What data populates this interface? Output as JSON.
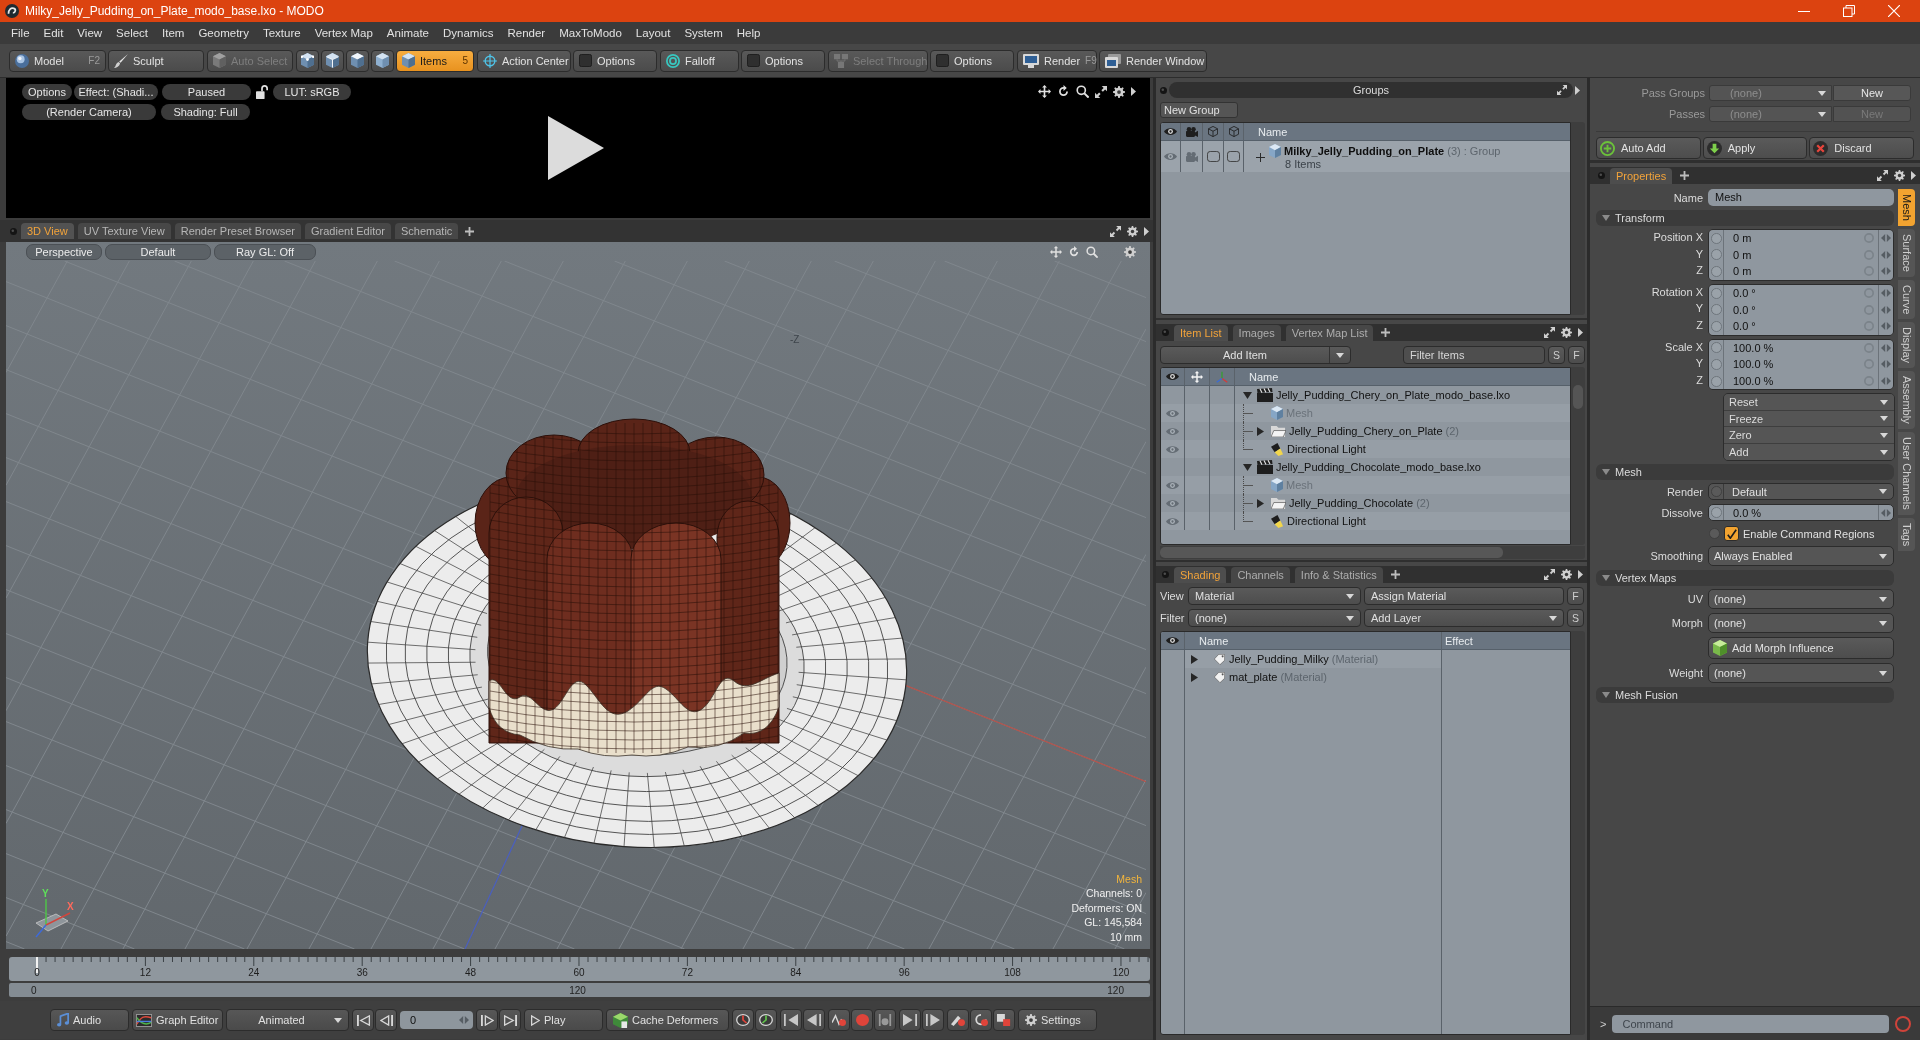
{
  "window": {
    "title": "Milky_Jelly_Pudding_on_Plate_modo_base.lxo - MODO"
  },
  "menu": [
    "File",
    "Edit",
    "View",
    "Select",
    "Item",
    "Geometry",
    "Texture",
    "Vertex Map",
    "Animate",
    "Dynamics",
    "Render",
    "MaxToModo",
    "Layout",
    "System",
    "Help"
  ],
  "toolbar": [
    {
      "items": [
        {
          "kind": "model",
          "label": "Model",
          "shortcut": "F2"
        },
        {
          "kind": "sculpt",
          "label": "Sculpt"
        }
      ]
    },
    {
      "items": [
        {
          "kind": "auto_select",
          "label": "Auto Select",
          "disabled": true
        }
      ]
    },
    {
      "items": [
        {
          "kind": "vertices",
          "selected": false
        },
        {
          "kind": "edges",
          "selected": false
        },
        {
          "kind": "polygons",
          "selected": false
        },
        {
          "kind": "materials",
          "selected": false
        },
        {
          "kind": "items",
          "label": "Items",
          "shortcut": "5",
          "selected": true
        }
      ]
    },
    {
      "items": [
        {
          "kind": "action_center",
          "label": "Action Center"
        },
        {
          "kind": "options",
          "label": "Options"
        }
      ]
    },
    {
      "items": [
        {
          "kind": "falloff",
          "label": "Falloff"
        },
        {
          "kind": "options",
          "label": "Options"
        }
      ]
    },
    {
      "items": [
        {
          "kind": "select_through",
          "label": "Select Through",
          "disabled": true
        },
        {
          "kind": "options",
          "label": "Options",
          "disabled": false
        }
      ]
    },
    {
      "items": [
        {
          "kind": "render",
          "label": "Render",
          "shortcut": "F9"
        },
        {
          "kind": "render_window",
          "label": "Render Window"
        }
      ]
    }
  ],
  "render_preview": {
    "row_1": [
      "Options",
      "Effect: (Shadi...",
      "Paused"
    ],
    "lut": "LUT: sRGB",
    "row_2": [
      "(Render Camera)",
      "Shading: Full"
    ]
  },
  "viewport": {
    "tabs": [
      {
        "label": "3D View",
        "selected": true
      },
      {
        "label": "UV Texture View",
        "selected": false
      },
      {
        "label": "Render Preset Browser",
        "selected": false
      },
      {
        "label": "Gradient Editor",
        "selected": false
      },
      {
        "label": "Schematic",
        "selected": false
      }
    ],
    "options": [
      "Perspective",
      "Default",
      "Ray GL: Off"
    ],
    "direction_label": "-Z",
    "gizmo_labels": [
      "Y",
      "X"
    ],
    "info_title": "Mesh",
    "info_lines": [
      "Channels: 0",
      "Deformers: ON",
      "GL: 145,584",
      "10 mm"
    ]
  },
  "timeline": {
    "ticks": [
      "0",
      "12",
      "24",
      "36",
      "48",
      "60",
      "72",
      "84",
      "96",
      "108",
      "120"
    ],
    "range_start": "0",
    "range_middle": "120",
    "range_end": "120"
  },
  "transport": {
    "audio": "Audio",
    "graph_editor": "Graph Editor",
    "mode": "Animated",
    "frame": "0",
    "play": "Play",
    "cache": "Cache Deformers",
    "settings": "Settings"
  },
  "groups": {
    "title": "Groups",
    "new_group": "New Group",
    "column": "Name",
    "rows": [
      {
        "name": "Milky_Jelly_Pudding_on_Plate",
        "count": "(3)",
        "type": ": Group",
        "detail": "8 Items",
        "expanded": false,
        "visible": true,
        "render": true,
        "toggles": [
          {
            "checked": false
          },
          {
            "checked": false
          }
        ]
      }
    ]
  },
  "item_list": {
    "tabs": [
      {
        "label": "Item List",
        "selected": true
      },
      {
        "label": "Images",
        "selected": false
      },
      {
        "label": "Vertex Map List",
        "selected": false
      }
    ],
    "add_item": "Add Item",
    "filter": {
      "placeholder": "Filter Items"
    },
    "toggle_s": "S",
    "toggle_f": "F",
    "column": "Name",
    "tree": [
      {
        "kind": "scene",
        "name": "Jelly_Pudding_Chery_on_Plate_modo_base.lxo",
        "expanded": true,
        "children": [
          {
            "kind": "mesh",
            "name": "Mesh",
            "visible": true,
            "dimmed": true
          },
          {
            "kind": "group",
            "name": "Jelly_Pudding_Chery_on_Plate",
            "count": "(2)",
            "visible": true,
            "dimmed": false,
            "expanded": false
          },
          {
            "kind": "light",
            "name": "Directional Light",
            "visible": true,
            "dimmed": false
          }
        ]
      },
      {
        "kind": "scene",
        "name": "Jelly_Pudding_Chocolate_modo_base.lxo",
        "expanded": true,
        "children": [
          {
            "kind": "mesh",
            "name": "Mesh",
            "visible": true,
            "dimmed": true
          },
          {
            "kind": "group",
            "name": "Jelly_Pudding_Chocolate",
            "count": "(2)",
            "visible": true,
            "dimmed": false,
            "expanded": false
          },
          {
            "kind": "light",
            "name": "Directional Light",
            "visible": true,
            "dimmed": false
          }
        ]
      }
    ]
  },
  "shading": {
    "tabs": [
      {
        "label": "Shading",
        "selected": true
      },
      {
        "label": "Channels",
        "selected": false
      },
      {
        "label": "Info & Statistics",
        "selected": false
      }
    ],
    "view_label": "View",
    "view": "Material",
    "assign": "Assign Material",
    "toggle_f": "F",
    "filter_label": "Filter",
    "filter": "(none)",
    "add_layer": "Add Layer",
    "toggle_s": "S",
    "columns": [
      "Name",
      "Effect"
    ],
    "rows": [
      {
        "name": "Jelly_Pudding_Milky",
        "type": "(Material)",
        "expanded": false
      },
      {
        "name": "mat_plate",
        "type": "(Material)",
        "expanded": false
      }
    ]
  },
  "passes": [
    {
      "label": "Pass Groups",
      "value": "(none)",
      "button": "New",
      "disabled": false
    },
    {
      "label": "Passes",
      "value": "(none)",
      "button": "New",
      "disabled": true
    }
  ],
  "actions": [
    {
      "kind": "auto_add",
      "label": "Auto Add"
    },
    {
      "kind": "apply",
      "label": "Apply"
    },
    {
      "kind": "discard",
      "label": "Discard"
    }
  ],
  "properties": {
    "tabs": [
      {
        "label": "Properties",
        "selected": true
      }
    ],
    "name_label": "Name",
    "name": "Mesh",
    "sections": [
      {
        "title": "Transform",
        "expanded": true,
        "rows": [
          {
            "kind": "vector",
            "labels": [
              "Position X",
              "Y",
              "Z"
            ],
            "values": [
              "0 m",
              "0 m",
              "0 m"
            ]
          },
          {
            "kind": "vector",
            "labels": [
              "Rotation X",
              "Y",
              "Z"
            ],
            "values": [
              "0.0 °",
              "0.0 °",
              "0.0 °"
            ]
          },
          {
            "kind": "vector",
            "labels": [
              "Scale X",
              "Y",
              "Z"
            ],
            "values": [
              "100.0 %",
              "100.0 %",
              "100.0 %"
            ]
          },
          {
            "kind": "menus",
            "items": [
              "Reset",
              "Freeze",
              "Zero",
              "Add"
            ]
          }
        ]
      },
      {
        "title": "Mesh",
        "expanded": true,
        "rows": [
          {
            "kind": "dropdown",
            "label": "Render",
            "value": "Default",
            "keyable": true
          },
          {
            "kind": "number",
            "label": "Dissolve",
            "value": "0.0 %"
          },
          {
            "kind": "checkbox",
            "label": "Enable Command Regions",
            "checked": true
          },
          {
            "kind": "dropdown",
            "label": "Smoothing",
            "value": "Always Enabled",
            "keyable": false
          }
        ]
      },
      {
        "title": "Vertex Maps",
        "expanded": true,
        "rows": [
          {
            "kind": "dropdown",
            "label": "UV",
            "value": "(none)",
            "keyable": false
          },
          {
            "kind": "dropdown",
            "label": "Morph",
            "value": "(none)",
            "keyable": false
          },
          {
            "kind": "button",
            "label": "Add Morph Influence"
          },
          {
            "kind": "dropdown",
            "label": "Weight",
            "value": "(none)",
            "keyable": false
          }
        ]
      },
      {
        "title": "Mesh Fusion",
        "expanded": true
      }
    ],
    "side_tabs": [
      {
        "label": "Mesh",
        "selected": true
      },
      {
        "label": "Surface",
        "selected": false
      },
      {
        "label": "Curve",
        "selected": false
      },
      {
        "label": "Display",
        "selected": false
      },
      {
        "label": "Assembly",
        "selected": false
      },
      {
        "label": "User Channels",
        "selected": false
      },
      {
        "label": "Tags",
        "selected": false
      }
    ]
  },
  "command": {
    "prompt": ">",
    "placeholder": "Command"
  }
}
